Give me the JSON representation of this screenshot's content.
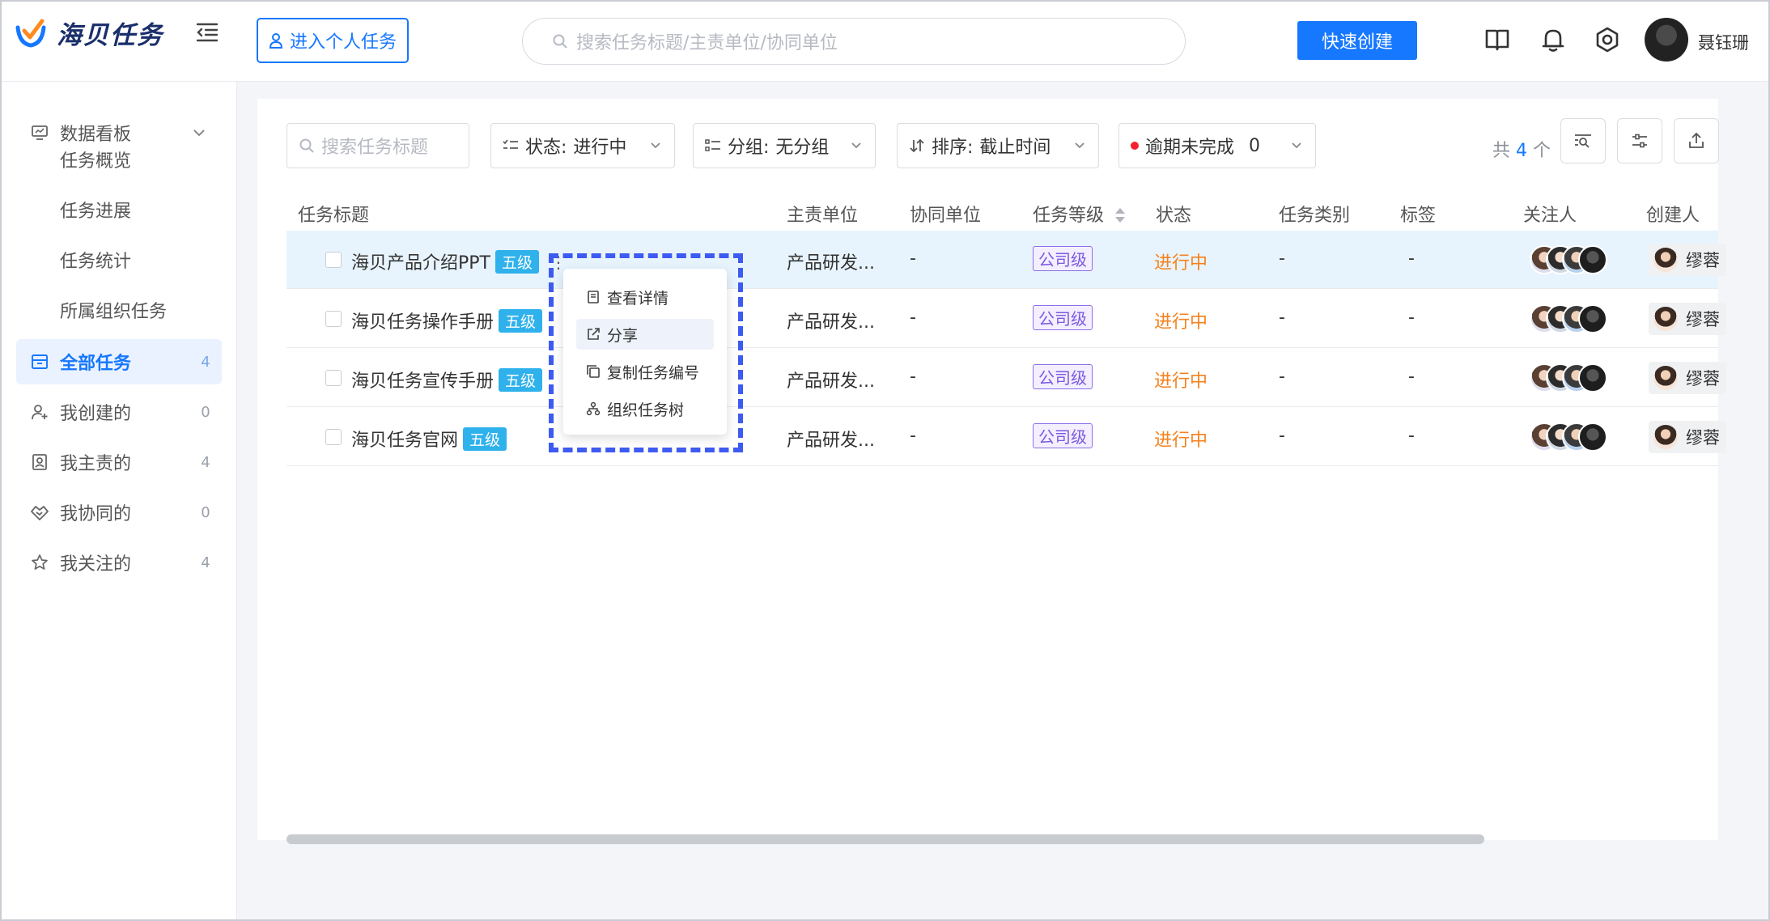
{
  "app": {
    "name": "海贝任务"
  },
  "header": {
    "personal_btn": "进入个人任务",
    "search_placeholder": "搜索任务标题/主责单位/协同单位",
    "quick_create": "快速创建",
    "user": "聂钰珊"
  },
  "sidebar": {
    "dashboard": {
      "label": "数据看板",
      "children": [
        "任务概览",
        "任务进展",
        "任务统计",
        "所属组织任务"
      ]
    },
    "items": [
      {
        "label": "全部任务",
        "count": "4"
      },
      {
        "label": "我创建的",
        "count": "0"
      },
      {
        "label": "我主责的",
        "count": "4"
      },
      {
        "label": "我协同的",
        "count": "0"
      },
      {
        "label": "我关注的",
        "count": "4"
      }
    ]
  },
  "filters": {
    "search_placeholder": "搜索任务标题",
    "status_label": "状态:",
    "status_value": "进行中",
    "group_label": "分组:",
    "group_value": "无分组",
    "sort_label": "排序:",
    "sort_value": "截止时间",
    "overdue_label": "逾期未完成",
    "overdue_count": "0",
    "total_prefix": "共",
    "total_count": "4",
    "total_suffix": "个"
  },
  "table": {
    "columns": [
      "任务标题",
      "主责单位",
      "协同单位",
      "任务等级",
      "状态",
      "任务类别",
      "标签",
      "关注人",
      "创建人"
    ],
    "rows": [
      {
        "title": "海贝产品介绍PPT",
        "level": "五级",
        "unit": "产品研发...",
        "co_unit": "-",
        "grade": "公司级",
        "status": "进行中",
        "category": "-",
        "tag": "-",
        "creator": "缪蓉"
      },
      {
        "title": "海贝任务操作手册",
        "level": "五级",
        "unit": "产品研发...",
        "co_unit": "-",
        "grade": "公司级",
        "status": "进行中",
        "category": "-",
        "tag": "-",
        "creator": "缪蓉"
      },
      {
        "title": "海贝任务宣传手册",
        "level": "五级",
        "unit": "产品研发...",
        "co_unit": "-",
        "grade": "公司级",
        "status": "进行中",
        "category": "-",
        "tag": "-",
        "creator": "缪蓉"
      },
      {
        "title": "海贝任务官网",
        "level": "五级",
        "unit": "产品研发...",
        "co_unit": "-",
        "grade": "公司级",
        "status": "进行中",
        "category": "-",
        "tag": "-",
        "creator": "缪蓉"
      }
    ]
  },
  "context_menu": {
    "items": [
      "查看详情",
      "分享",
      "复制任务编号",
      "组织任务树"
    ]
  },
  "colors": {
    "primary": "#1677ff",
    "status": "#f5821f",
    "grade": "#7b5ae0",
    "level_tag": "#2fb1ec",
    "highlight": "#3d5af1"
  }
}
